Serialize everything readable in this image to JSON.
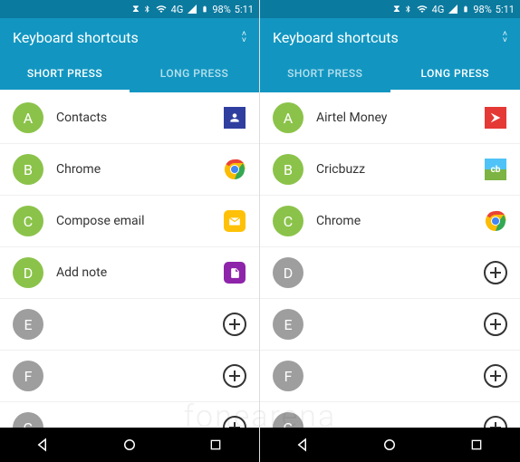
{
  "status": {
    "network": "4G",
    "battery": "98%",
    "time": "5:11"
  },
  "title": "Keyboard shortcuts",
  "tabs": {
    "short": "SHORT PRESS",
    "long": "LONG PRESS"
  },
  "left": {
    "rows": [
      {
        "letter": "A",
        "assigned": true,
        "label": "Contacts",
        "icon": "contacts"
      },
      {
        "letter": "B",
        "assigned": true,
        "label": "Chrome",
        "icon": "chrome"
      },
      {
        "letter": "C",
        "assigned": true,
        "label": "Compose email",
        "icon": "mail"
      },
      {
        "letter": "D",
        "assigned": true,
        "label": "Add note",
        "icon": "note"
      },
      {
        "letter": "E",
        "assigned": false,
        "label": "",
        "icon": "add"
      },
      {
        "letter": "F",
        "assigned": false,
        "label": "",
        "icon": "add"
      },
      {
        "letter": "G",
        "assigned": false,
        "label": "",
        "icon": "add"
      }
    ]
  },
  "right": {
    "rows": [
      {
        "letter": "A",
        "assigned": true,
        "label": "Airtel Money",
        "icon": "airtel"
      },
      {
        "letter": "B",
        "assigned": true,
        "label": "Cricbuzz",
        "icon": "cricbuzz"
      },
      {
        "letter": "C",
        "assigned": true,
        "label": "Chrome",
        "icon": "chrome"
      },
      {
        "letter": "D",
        "assigned": false,
        "label": "",
        "icon": "add"
      },
      {
        "letter": "E",
        "assigned": false,
        "label": "",
        "icon": "add"
      },
      {
        "letter": "F",
        "assigned": false,
        "label": "",
        "icon": "add"
      },
      {
        "letter": "G",
        "assigned": false,
        "label": "",
        "icon": "add"
      }
    ]
  },
  "watermark": "fonearena"
}
